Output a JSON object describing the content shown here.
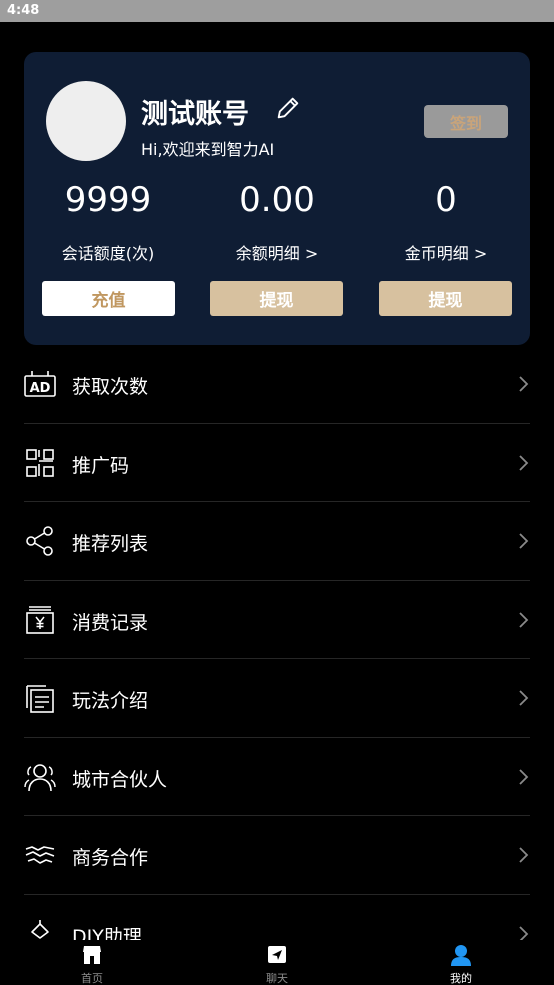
{
  "status_bar": {
    "time": "4:48"
  },
  "profile": {
    "name": "测试账号",
    "welcome": "Hi,欢迎来到智力AI",
    "signin_label": "签到"
  },
  "stats": [
    {
      "value": "9999",
      "label": "会话额度(次)",
      "button": "充值"
    },
    {
      "value": "0.00",
      "label": "余额明细 >",
      "button": "提现"
    },
    {
      "value": "0",
      "label": "金币明细 >",
      "button": "提现"
    }
  ],
  "menu": [
    {
      "label": "获取次数",
      "icon": "ad-icon"
    },
    {
      "label": "推广码",
      "icon": "qr-code-icon"
    },
    {
      "label": "推荐列表",
      "icon": "share-icon"
    },
    {
      "label": "消费记录",
      "icon": "receipt-yen-icon"
    },
    {
      "label": "玩法介绍",
      "icon": "document-icon"
    },
    {
      "label": "城市合伙人",
      "icon": "users-icon"
    },
    {
      "label": "商务合作",
      "icon": "handshake-icon"
    },
    {
      "label": "DIY助理",
      "icon": "diy-assistant-icon"
    }
  ],
  "bottom_nav": [
    {
      "label": "首页",
      "icon": "store-icon"
    },
    {
      "label": "聊天",
      "icon": "chat-send-icon"
    },
    {
      "label": "我的",
      "icon": "person-icon",
      "active": true
    }
  ],
  "colors": {
    "card_bg": "#0f1d34",
    "gold_button": "#d7c19f",
    "gold_text": "#c09760",
    "active_tab": "#2196f3"
  }
}
